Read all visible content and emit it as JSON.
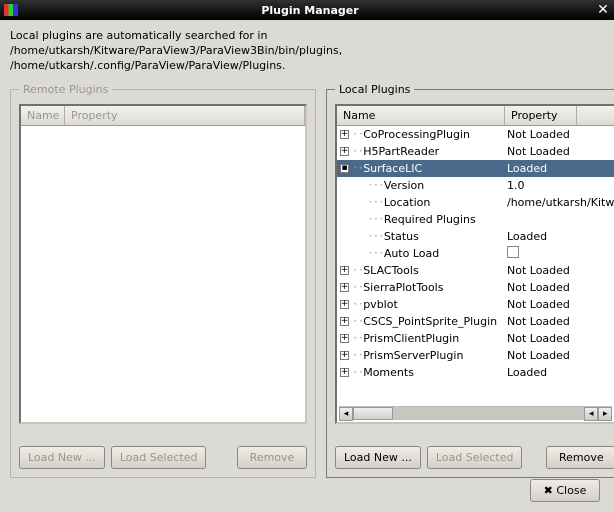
{
  "window": {
    "title": "Plugin Manager"
  },
  "info": {
    "line1": "Local plugins are automatically searched for in",
    "line2": "/home/utkarsh/Kitware/ParaView3/ParaView3Bin/bin/plugins,",
    "line3": "/home/utkarsh/.config/ParaView/ParaView/Plugins."
  },
  "remote": {
    "legend": "Remote Plugins",
    "col_name": "Name",
    "col_prop": "Property"
  },
  "local": {
    "legend": "Local Plugins",
    "col_name": "Name",
    "col_prop": "Property",
    "items": [
      {
        "name": "CoProcessingPlugin",
        "prop": "Not Loaded",
        "expanded": false
      },
      {
        "name": "H5PartReader",
        "prop": "Not Loaded",
        "expanded": false
      },
      {
        "name": "SurfaceLIC",
        "prop": "Loaded",
        "expanded": true,
        "selected": true,
        "children": [
          {
            "name": "Version",
            "prop": "1.0"
          },
          {
            "name": "Location",
            "prop": "/home/utkarsh/Kitw"
          },
          {
            "name": "Required Plugins",
            "prop": ""
          },
          {
            "name": "Status",
            "prop": "Loaded"
          },
          {
            "name": "Auto Load",
            "prop": "",
            "checkbox": true
          }
        ]
      },
      {
        "name": "SLACTools",
        "prop": "Not Loaded",
        "expanded": false
      },
      {
        "name": "SierraPlotTools",
        "prop": "Not Loaded",
        "expanded": false
      },
      {
        "name": "pvblot",
        "prop": "Not Loaded",
        "expanded": false
      },
      {
        "name": "CSCS_PointSprite_Plugin",
        "prop": "Not Loaded",
        "expanded": false
      },
      {
        "name": "PrismClientPlugin",
        "prop": "Not Loaded",
        "expanded": false
      },
      {
        "name": "PrismServerPlugin",
        "prop": "Not Loaded",
        "expanded": false
      },
      {
        "name": "Moments",
        "prop": "Loaded",
        "expanded": false
      }
    ]
  },
  "buttons": {
    "load_new": "Load New ...",
    "load_selected": "Load Selected",
    "remove": "Remove",
    "close": "Close"
  },
  "layout": {
    "local_col1_width": 168,
    "local_col2_width": 72,
    "remote_col1_width": 44,
    "remote_col2_width": 240
  }
}
